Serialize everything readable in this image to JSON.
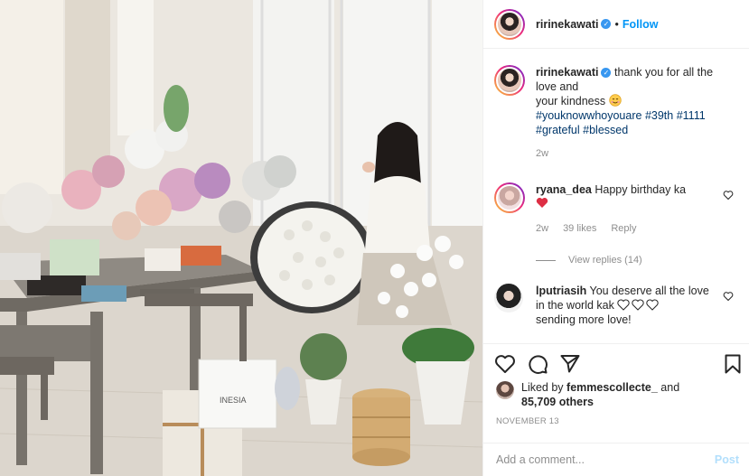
{
  "post": {
    "username": "ririnekawati",
    "verified": true,
    "separator": "•",
    "follow_label": "Follow",
    "photo_box_text": "INESIA"
  },
  "caption": {
    "username": "ririnekawati",
    "line1": "thank you for all the love and",
    "line2": "your kindness",
    "emoji": "smiling-face-icon",
    "hashtags": [
      "#youknowwhoyouare",
      "#39th",
      "#1111",
      "#grateful",
      "#blessed"
    ],
    "time": "2w"
  },
  "comments": [
    {
      "username": "ryana_dea",
      "text": "Happy birthday ka",
      "emoji": "red-heart-icon",
      "time": "2w",
      "likes": "39 likes",
      "reply_label": "Reply",
      "view_replies": "View replies (14)"
    },
    {
      "username": "lputriasih",
      "text": "You deserve all the love in the world kak",
      "emoji": "white-hearts-icon",
      "trailing": "sending more love!"
    }
  ],
  "actions": {
    "like_icon": "heart-outline-icon",
    "comment_icon": "comment-bubble-icon",
    "share_icon": "paper-plane-icon",
    "save_icon": "bookmark-icon"
  },
  "likes": {
    "prefix": "Liked by",
    "user": "femmescollecte_",
    "middle": "and",
    "count": "85,709 others"
  },
  "date": "NOVEMBER 13",
  "add_comment": {
    "placeholder": "Add a comment...",
    "post_label": "Post"
  },
  "colors": {
    "accent": "#0095f6",
    "verified": "#3897f0",
    "hashtag": "#00376b",
    "muted": "#8e8e8e",
    "heart": "#ed4956"
  }
}
